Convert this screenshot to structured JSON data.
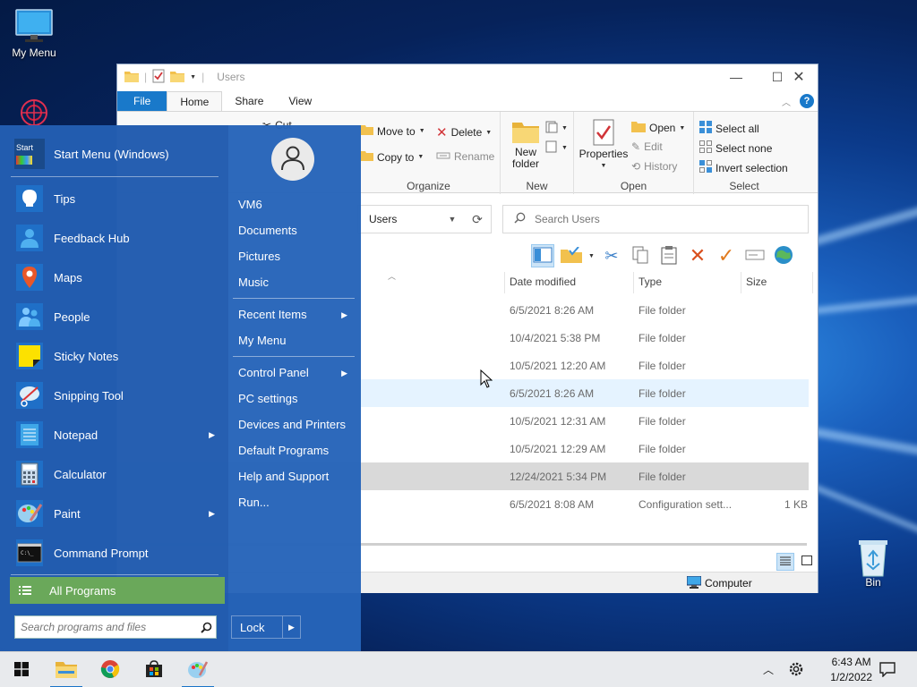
{
  "desktop": {
    "icons": [
      {
        "label": "My Menu"
      },
      {
        "label": "Bin"
      }
    ]
  },
  "explorer": {
    "title": "Users",
    "window_controls": {
      "minimize": "—",
      "maximize": "☐",
      "close": "✕"
    },
    "tabs": {
      "file": "File",
      "home": "Home",
      "share": "Share",
      "view": "View"
    },
    "ribbon": {
      "cut": "Cut",
      "move_to": "Move to",
      "copy_to": "Copy to",
      "delete": "Delete",
      "rename": "Rename",
      "organize": "Organize",
      "new_folder_1": "New",
      "new_folder_2": "folder",
      "new": "New",
      "properties": "Properties",
      "open": "Open",
      "edit": "Edit",
      "history": "History",
      "open_group": "Open",
      "select_all": "Select all",
      "select_none": "Select none",
      "invert_selection": "Invert selection",
      "select_group": "Select"
    },
    "address": {
      "path": "Users"
    },
    "search": {
      "placeholder": "Search Users"
    },
    "columns": {
      "date": "Date modified",
      "type": "Type",
      "size": "Size"
    },
    "rows": [
      {
        "date": "6/5/2021 8:26 AM",
        "type": "File folder",
        "size": ""
      },
      {
        "date": "10/4/2021 5:38 PM",
        "type": "File folder",
        "size": ""
      },
      {
        "date": "10/5/2021 12:20 AM",
        "type": "File folder",
        "size": ""
      },
      {
        "date": "6/5/2021 8:26 AM",
        "type": "File folder",
        "size": ""
      },
      {
        "date": "10/5/2021 12:31 AM",
        "type": "File folder",
        "size": ""
      },
      {
        "date": "10/5/2021 12:29 AM",
        "type": "File folder",
        "size": ""
      },
      {
        "date": "12/24/2021 5:34 PM",
        "type": "File folder",
        "size": ""
      },
      {
        "date": "6/5/2021 8:08 AM",
        "type": "Configuration sett...",
        "size": "1 KB"
      }
    ],
    "status": {
      "location": "Computer"
    }
  },
  "start_menu": {
    "header": "Start Menu (Windows)",
    "header_icon_text": "Start",
    "pinned": [
      {
        "label": "Tips",
        "submenu": false
      },
      {
        "label": "Feedback Hub",
        "submenu": false
      },
      {
        "label": "Maps",
        "submenu": false
      },
      {
        "label": "People",
        "submenu": false
      },
      {
        "label": "Sticky Notes",
        "submenu": false
      },
      {
        "label": "Snipping Tool",
        "submenu": false
      },
      {
        "label": "Notepad",
        "submenu": true
      },
      {
        "label": "Calculator",
        "submenu": false
      },
      {
        "label": "Paint",
        "submenu": true
      },
      {
        "label": "Command Prompt",
        "submenu": false
      }
    ],
    "all_programs": "All Programs",
    "search_placeholder": "Search programs and files",
    "right": {
      "user": "VM6",
      "documents": "Documents",
      "pictures": "Pictures",
      "music": "Music",
      "recent_items": "Recent Items",
      "my_menu": "My Menu",
      "control_panel": "Control Panel",
      "pc_settings": "PC settings",
      "devices_printers": "Devices and Printers",
      "default_programs": "Default Programs",
      "help_support": "Help and Support",
      "run": "Run..."
    },
    "lock": "Lock",
    "submenu_arrow": "▶"
  },
  "taskbar": {
    "time": "6:43 AM",
    "date": "1/2/2022"
  },
  "colors": {
    "accent": "#1979ca",
    "start_menu": "#2664b9",
    "all_programs": "#6aa85a"
  }
}
